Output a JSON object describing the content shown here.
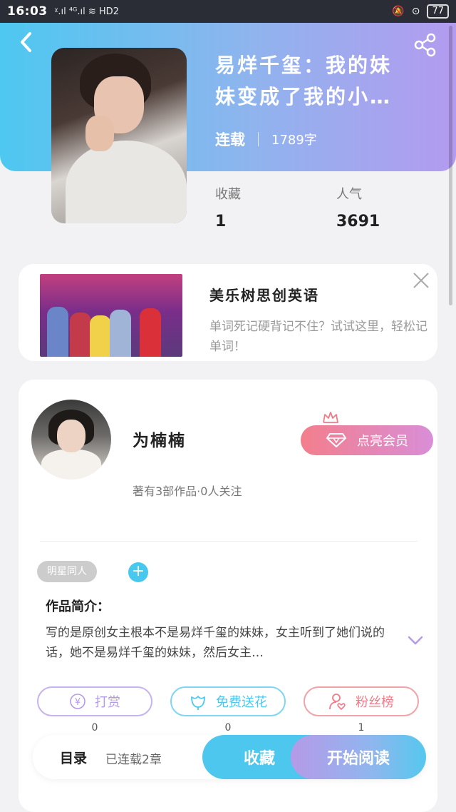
{
  "status_bar": {
    "time": "16:03",
    "signal": "ᵡ.ıl ⁴ᴳ.ıl  ≋ HD2",
    "battery": "77"
  },
  "book": {
    "title": "易烊千玺：我的妹妹变成了我的小…",
    "status": "连载",
    "word_count": "1789字",
    "stats": [
      {
        "label": "收藏",
        "value": "1"
      },
      {
        "label": "人气",
        "value": "3691"
      }
    ]
  },
  "ad": {
    "title": "美乐树思创英语",
    "desc": "单词死记硬背记不住？试试这里，轻松记单词！"
  },
  "author": {
    "name": "为楠楠",
    "sub": "著有3部作品·0人关注",
    "vip_label": "点亮会员"
  },
  "tags": [
    "明星同人"
  ],
  "intro": {
    "title": "作品简介：",
    "text": "写的是原创女主根本不是易烊千玺的妹妹，女主听到了她们说的话，她不是易烊千玺的妹妹，然后女主…"
  },
  "actions": [
    {
      "label": "打赏",
      "count": "0",
      "color": "#b59be6"
    },
    {
      "label": "免费送花",
      "count": "0",
      "color": "#4cc8ee"
    },
    {
      "label": "粉丝榜",
      "count": "1",
      "color": "#f07b87"
    }
  ],
  "bottom_bar": {
    "toc": "目录",
    "chapters": "已连载2章",
    "collect": "收藏",
    "read": "开始阅读"
  },
  "colors": {
    "primary": "#4dc8f0",
    "secondary": "#b39bef",
    "vip": "#f37e8c"
  }
}
